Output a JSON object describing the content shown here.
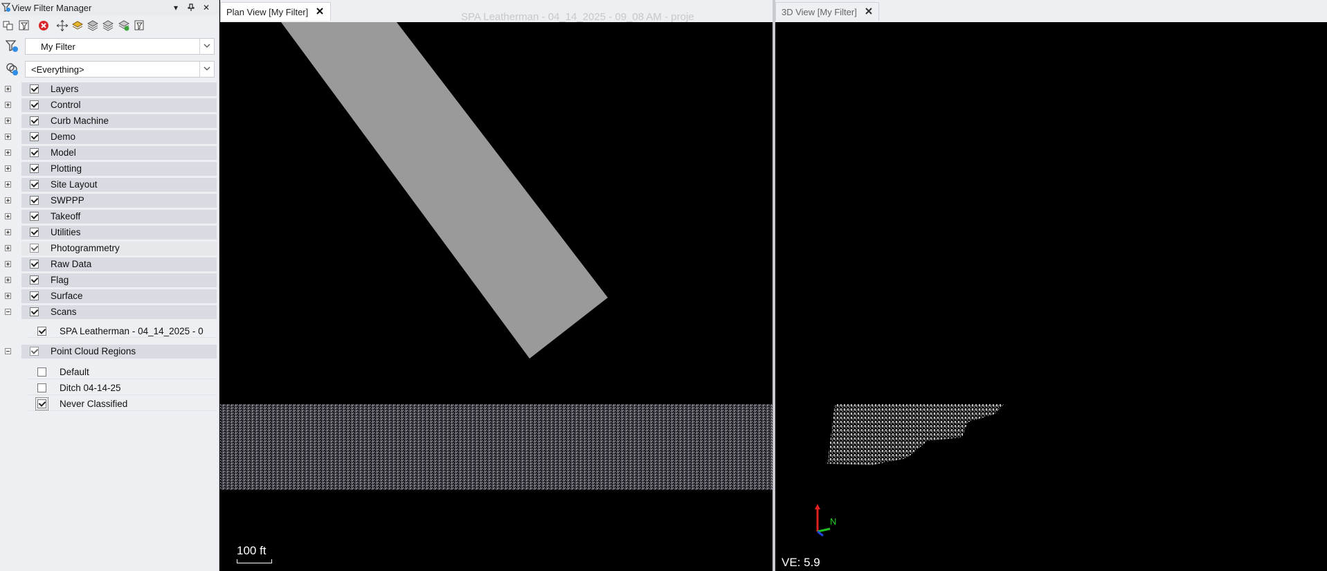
{
  "left_panel": {
    "title": "View Filter Manager",
    "filter_combo": "My Filter",
    "scope_combo": "<Everything>",
    "tree": [
      {
        "label": "Layers",
        "checked": true,
        "expander": "plus"
      },
      {
        "label": "Control",
        "checked": true,
        "expander": "plus"
      },
      {
        "label": "Curb Machine",
        "checked": true,
        "expander": "plus"
      },
      {
        "label": "Demo",
        "checked": true,
        "expander": "plus"
      },
      {
        "label": "Model",
        "checked": true,
        "expander": "plus"
      },
      {
        "label": "Plotting",
        "checked": true,
        "expander": "plus"
      },
      {
        "label": "Site Layout",
        "checked": true,
        "expander": "plus"
      },
      {
        "label": "SWPPP",
        "checked": true,
        "expander": "plus"
      },
      {
        "label": "Takeoff",
        "checked": true,
        "expander": "plus"
      },
      {
        "label": "Utilities",
        "checked": true,
        "expander": "plus"
      },
      {
        "label": "Photogrammetry",
        "checked": true,
        "expander": "plus"
      },
      {
        "label": "Raw Data",
        "checked": true,
        "expander": "plus"
      },
      {
        "label": "Flag",
        "checked": true,
        "expander": "plus"
      },
      {
        "label": "Surface",
        "checked": true,
        "expander": "plus"
      },
      {
        "label": "Scans",
        "checked": true,
        "expander": "minus"
      }
    ],
    "scans_child": {
      "label": "SPA Leatherman - 04_14_2025 - 0",
      "checked": true
    },
    "point_cloud_regions": {
      "label": "Point Cloud Regions",
      "checked": true
    },
    "regions": [
      {
        "label": "Default",
        "checked": false
      },
      {
        "label": "Ditch 04-14-25",
        "checked": false
      },
      {
        "label": "Never Classified",
        "checked": true
      }
    ]
  },
  "plan_view": {
    "tab_label": "Plan View [My Filter]",
    "header_text": "SPA Leatherman - 04_14_2025 - 09_08 AM - proje",
    "scale_label": "100 ft"
  },
  "view_3d": {
    "tab_label": "3D View [My Filter]",
    "ve_label": "VE: 5.9",
    "axis_label": "N"
  },
  "colors": {
    "panel_bg": "#eeeff2",
    "row_bar": "#d9dbe2",
    "road_gray": "#9a9a9a",
    "viewport_bg": "#000000"
  }
}
